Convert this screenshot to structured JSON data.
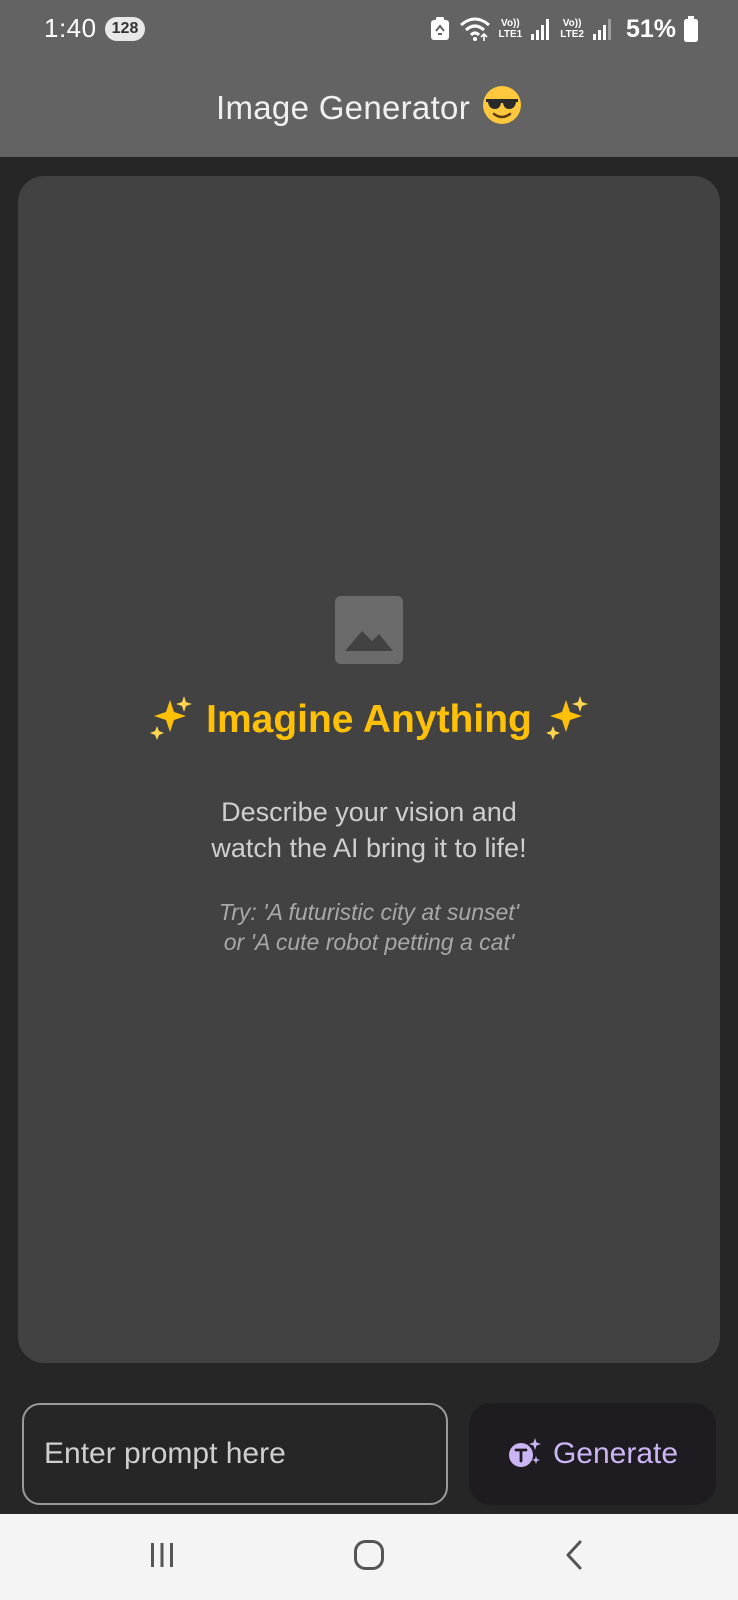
{
  "status_bar": {
    "time": "1:40",
    "badge": "128",
    "lte1": [
      "Vo))",
      "LTE1"
    ],
    "lte2": [
      "Vo))",
      "LTE2"
    ],
    "battery": "51%"
  },
  "app_bar": {
    "title": "Image Generator",
    "title_emoji": "smiling-face-with-sunglasses-icon"
  },
  "empty_state": {
    "icon": "image-placeholder-icon",
    "headline": "Imagine Anything",
    "headline_decoration": "sparkles-icon",
    "subtitle_line1": "Describe your vision and",
    "subtitle_line2": "watch the AI bring it to life!",
    "hint_line1": "Try: 'A futuristic city at sunset'",
    "hint_line2": "or 'A cute robot petting a cat'"
  },
  "prompt": {
    "placeholder": "Enter prompt here",
    "value": ""
  },
  "generate_button": {
    "label": "Generate",
    "icon": "ai-text-sparkle-icon"
  },
  "nav_bar": {
    "recents_icon": "recents-icon",
    "home_icon": "home-icon",
    "back_icon": "back-icon"
  },
  "colors": {
    "app_bar": "#636363",
    "background": "#262626",
    "card": "#424242",
    "accent_headline": "#ffc107",
    "button_label": "#cbb5f5",
    "button_bg": "#1e1c21"
  }
}
